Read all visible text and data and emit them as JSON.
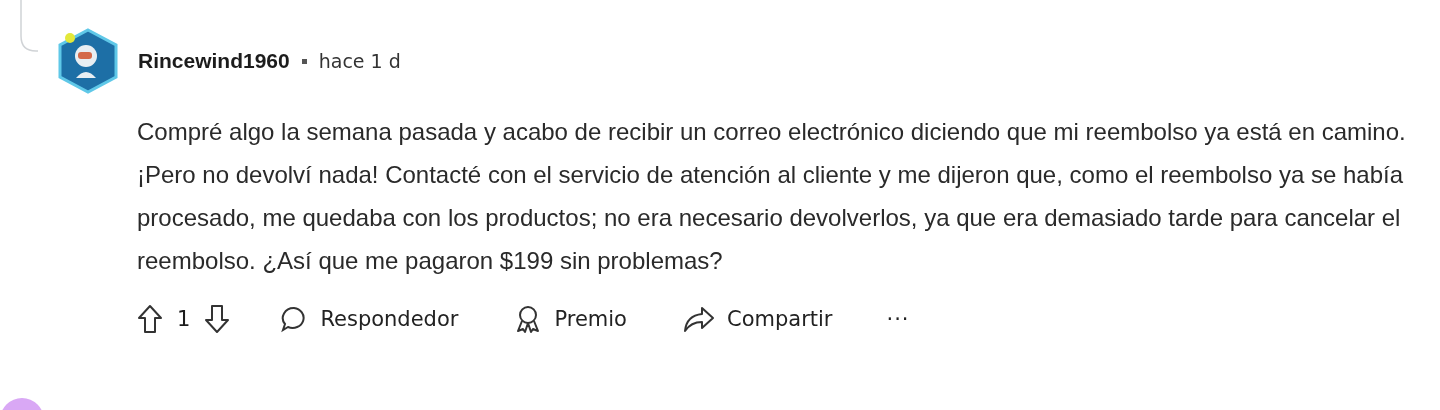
{
  "comment": {
    "author": "Rincewind1960",
    "time": "hace 1 d",
    "body": "Compré algo la semana pasada y acabo de recibir un correo electrónico diciendo que mi reembolso ya está en camino. ¡Pero no devolví nada! Contacté con el servicio de atención al cliente y me dijeron que, como el reembolso ya se había procesado, me quedaba con los productos; no era necesario devolverlos, ya que era demasiado tarde para cancelar el reembolso. ¿Así que me pagaron $199 sin problemas?",
    "votes": "1",
    "actions": [
      {
        "kind": "reply",
        "label": "Respondedor"
      },
      {
        "kind": "award",
        "label": "Premio"
      },
      {
        "kind": "share",
        "label": "Compartir"
      },
      {
        "kind": "more",
        "label": "···"
      }
    ]
  }
}
